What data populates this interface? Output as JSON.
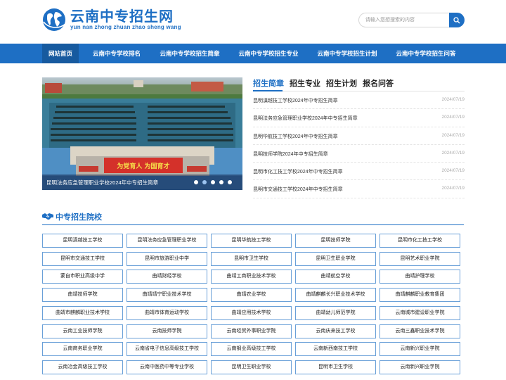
{
  "header": {
    "logo_title": "云南中专招生网",
    "logo_sub": "yun nan zhong zhuan zhao sheng wang",
    "search_placeholder": "请输入您想搜索的内容"
  },
  "nav": [
    {
      "label": "网站首页",
      "active": true
    },
    {
      "label": "云南中专学校排名"
    },
    {
      "label": "云南中专学校招生简章"
    },
    {
      "label": "云南中专学校招生专业"
    },
    {
      "label": "云南中专学校招生计划"
    },
    {
      "label": "云南中专学校招生问答"
    }
  ],
  "banner": {
    "caption": "昆明法务应急管理职业学校2024年中专招生简章",
    "slogan": "为党育人 为国育才",
    "slides": 5,
    "current_slide": 2
  },
  "tabs": [
    "招生简章",
    "招生专业",
    "招生计划",
    "报名问答"
  ],
  "news": [
    {
      "title": "昆明滇越技工学校2024年中专招生简章",
      "date": "2024/07/19"
    },
    {
      "title": "昆明法务应急管理职业学校2024年中专招生简章",
      "date": "2024/07/19"
    },
    {
      "title": "昆明华航技工学校2024年中专招生简章",
      "date": "2024/07/19"
    },
    {
      "title": "昆明技师学院2024年中专招生简章",
      "date": "2024/07/19"
    },
    {
      "title": "昆明市化工技工学校2024年中专招生简章",
      "date": "2024/07/19"
    },
    {
      "title": "昆明市交通技工学校2024年中专招生简章",
      "date": "2024/07/19"
    }
  ],
  "section": {
    "title": "中专招生院校"
  },
  "schools": [
    "昆明滇越技工学校",
    "昆明法务应急管理职业学校",
    "昆明华航技工学校",
    "昆明技师学院",
    "昆明市化工技工学校",
    "昆明市交通技工学校",
    "昆明市旅游职业中学",
    "昆明市卫生学校",
    "昆明卫生职业学院",
    "昆明艺术职业学院",
    "蒙自市职业高级中学",
    "曲靖财经学校",
    "曲靖工商职业技术学校",
    "曲靖航空学校",
    "曲靖护理学校",
    "曲靖技师学院",
    "曲靖靖宁职业技术学校",
    "曲靖农业学校",
    "曲靖麒麟长兴职业技术学校",
    "曲靖麒麟职业教育集团",
    "曲靖市麒麟职业技术学校",
    "曲靖市体育运动学校",
    "曲靖应用技术学校",
    "曲靖幼儿师范学院",
    "云南城市建设职业学院",
    "云南工业技师学院",
    "云南技师学院",
    "云南经贸外事职业学院",
    "云南庆来技工学校",
    "云南三鑫职业技术学院",
    "云南商务职业学院",
    "云南省电子信息高级技工学校",
    "云南钢业高级技工学校",
    "云南新西南技工学校",
    "云南新兴职业学院",
    "云南冶金高级技工学校",
    "云南中医药中等专业学校",
    "昆明卫生职业学校",
    "昆明市卫生学校",
    "云南新兴职业学院"
  ],
  "colors": {
    "primary": "#1e6fc4",
    "nav_active": "#175a9f",
    "cell_border": "#6aa0d8"
  }
}
